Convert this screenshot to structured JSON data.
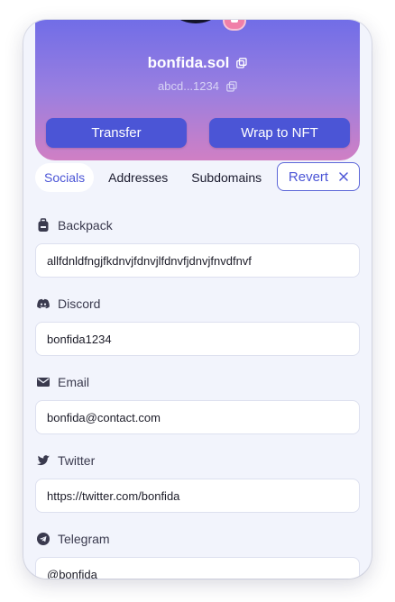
{
  "profile": {
    "domain": "bonfida.sol",
    "address": "abcd...1234"
  },
  "actions": {
    "transfer_label": "Transfer",
    "wrap_label": "Wrap to NFT"
  },
  "tabs": [
    {
      "label": "Socials",
      "active": true
    },
    {
      "label": "Addresses",
      "active": false
    },
    {
      "label": "Subdomains",
      "active": false
    }
  ],
  "revert_label": "Revert",
  "fields": [
    {
      "label": "Backpack",
      "value": "allfdnldfngjfkdnvjfdnvjlfdnvfjdnvjfnvdfnvf",
      "icon": "backpack-icon"
    },
    {
      "label": "Discord",
      "value": "bonfida1234",
      "icon": "discord-icon"
    },
    {
      "label": "Email",
      "value": "bonfida@contact.com",
      "icon": "email-icon"
    },
    {
      "label": "Twitter",
      "value": "https://twitter.com/bonfida",
      "icon": "twitter-icon"
    },
    {
      "label": "Telegram",
      "value": "@bonfida",
      "icon": "telegram-icon"
    }
  ],
  "colors": {
    "accent": "#4b55d6",
    "gradient_top": "#6a6ae8",
    "gradient_bottom": "#d07fc4",
    "background": "#f2f4fc"
  }
}
